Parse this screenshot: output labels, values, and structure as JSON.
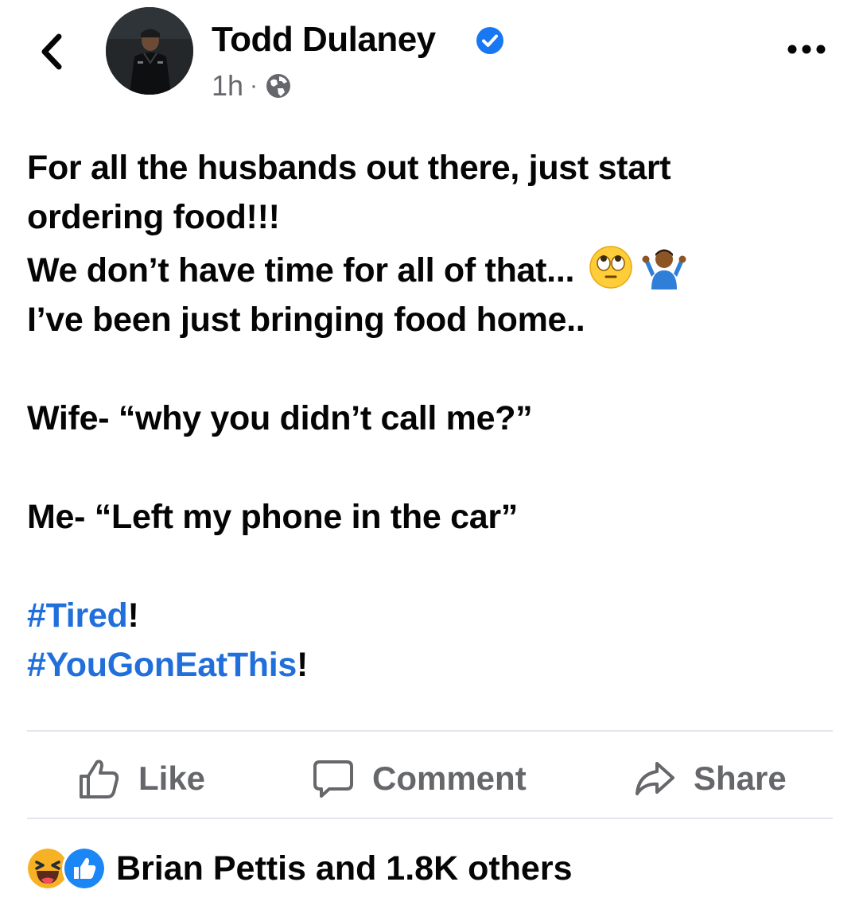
{
  "header": {
    "back_icon": "chevron-left-icon",
    "author_name": "Todd Dulaney",
    "verified_icon": "verified-badge-icon",
    "timestamp": "1h",
    "separator": "·",
    "audience_icon": "globe-icon",
    "more_icon": "more-horizontal-icon"
  },
  "post": {
    "line1": "For all the husbands out there,  just start ordering food!!!",
    "line2": "We don’t have time for all of that...",
    "line2_emojis": [
      "face-with-rolling-eyes-emoji",
      "man-shrugging-emoji"
    ],
    "line3": "I’ve been just bringing food home..",
    "line4": "Wife- “why you didn’t call me?”",
    "line5": "Me- “Left my phone in the car”",
    "hashtag1": "#Tired",
    "hashtag1_suffix": "!",
    "hashtag2": "#YouGonEatThis",
    "hashtag2_suffix": "!"
  },
  "actions": {
    "like_label": "Like",
    "comment_label": "Comment",
    "share_label": "Share"
  },
  "reactions": {
    "icons": [
      "haha-reaction-icon",
      "like-reaction-icon"
    ],
    "summary": "Brian Pettis and 1.8K others"
  },
  "colors": {
    "text": "#050505",
    "secondary": "#65676b",
    "hashtag": "#216fdb",
    "verified": "#1877f2",
    "divider": "#e4e6eb"
  }
}
